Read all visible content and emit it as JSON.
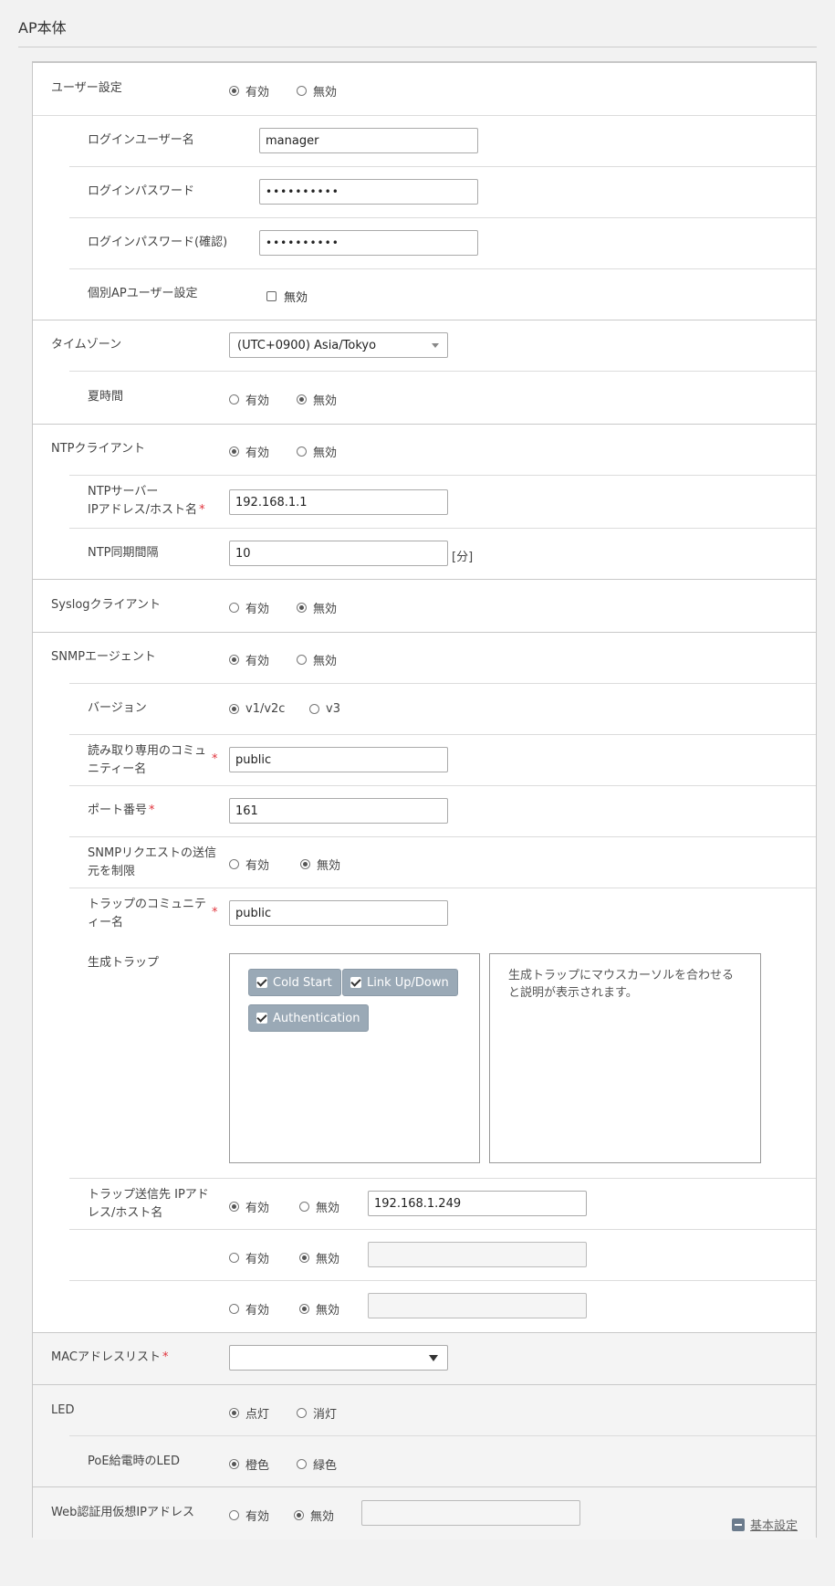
{
  "page": {
    "title": "AP本体"
  },
  "user": {
    "label": "ユーザー設定",
    "enable": "有効",
    "disable": "無効",
    "login_name_label": "ログインユーザー名",
    "login_name_value": "manager",
    "password_label": "ログインパスワード",
    "password_value": "••••••••••",
    "password_confirm_label": "ログインパスワード(確認)",
    "password_confirm_value": "••••••••••",
    "individual_label": "個別APユーザー設定",
    "individual_checkbox": "無効"
  },
  "timezone": {
    "label": "タイムゾーン",
    "value": "(UTC+0900) Asia/Tokyo",
    "dst_label": "夏時間",
    "enable": "有効",
    "disable": "無効"
  },
  "ntp": {
    "label": "NTPクライアント",
    "enable": "有効",
    "disable": "無効",
    "server_label_1": "NTPサーバー",
    "server_label_2": "IPアドレス/ホスト名",
    "required": "*",
    "server_value": "192.168.1.1",
    "interval_label": "NTP同期間隔",
    "interval_value": "10",
    "interval_unit": "[分]"
  },
  "syslog": {
    "label": "Syslogクライアント",
    "enable": "有効",
    "disable": "無効"
  },
  "snmp": {
    "label": "SNMPエージェント",
    "enable": "有効",
    "disable": "無効",
    "version_label": "バージョン",
    "v1": "v1/v2c",
    "v3": "v3",
    "community_label_1": "読み取り専用のコミュ",
    "community_label_2": "ニティー名",
    "community_value": "public",
    "port_label": "ポート番号",
    "port_value": "161",
    "restrict_label_1": "SNMPリクエストの送信",
    "restrict_label_2": "元を制限",
    "trap_community_label_1": "トラップのコミュニテ",
    "trap_community_label_2": "ィー名",
    "trap_community_value": "public",
    "traps_label": "生成トラップ",
    "traps": [
      "Cold Start",
      "Link Up/Down",
      "Authentication"
    ],
    "traps_help_1": "生成トラップにマウスカーソルを合わせる",
    "traps_help_2": "と説明が表示されます。",
    "trap_dest_label_1": "トラップ送信先 IPアド",
    "trap_dest_label_2": "レス/ホスト名",
    "trap_dest_value": "192.168.1.249",
    "trap_dest_value_2": "",
    "trap_dest_value_3": ""
  },
  "mac": {
    "label": "MACアドレスリスト",
    "value": ""
  },
  "led": {
    "label": "LED",
    "on": "点灯",
    "off": "消灯",
    "poe_label": "PoE給電時のLED",
    "orange": "橙色",
    "green": "緑色"
  },
  "webauth": {
    "label": "Web認証用仮想IPアドレス",
    "enable": "有効",
    "disable": "無効",
    "value": ""
  },
  "footer": {
    "link": "基本設定"
  }
}
